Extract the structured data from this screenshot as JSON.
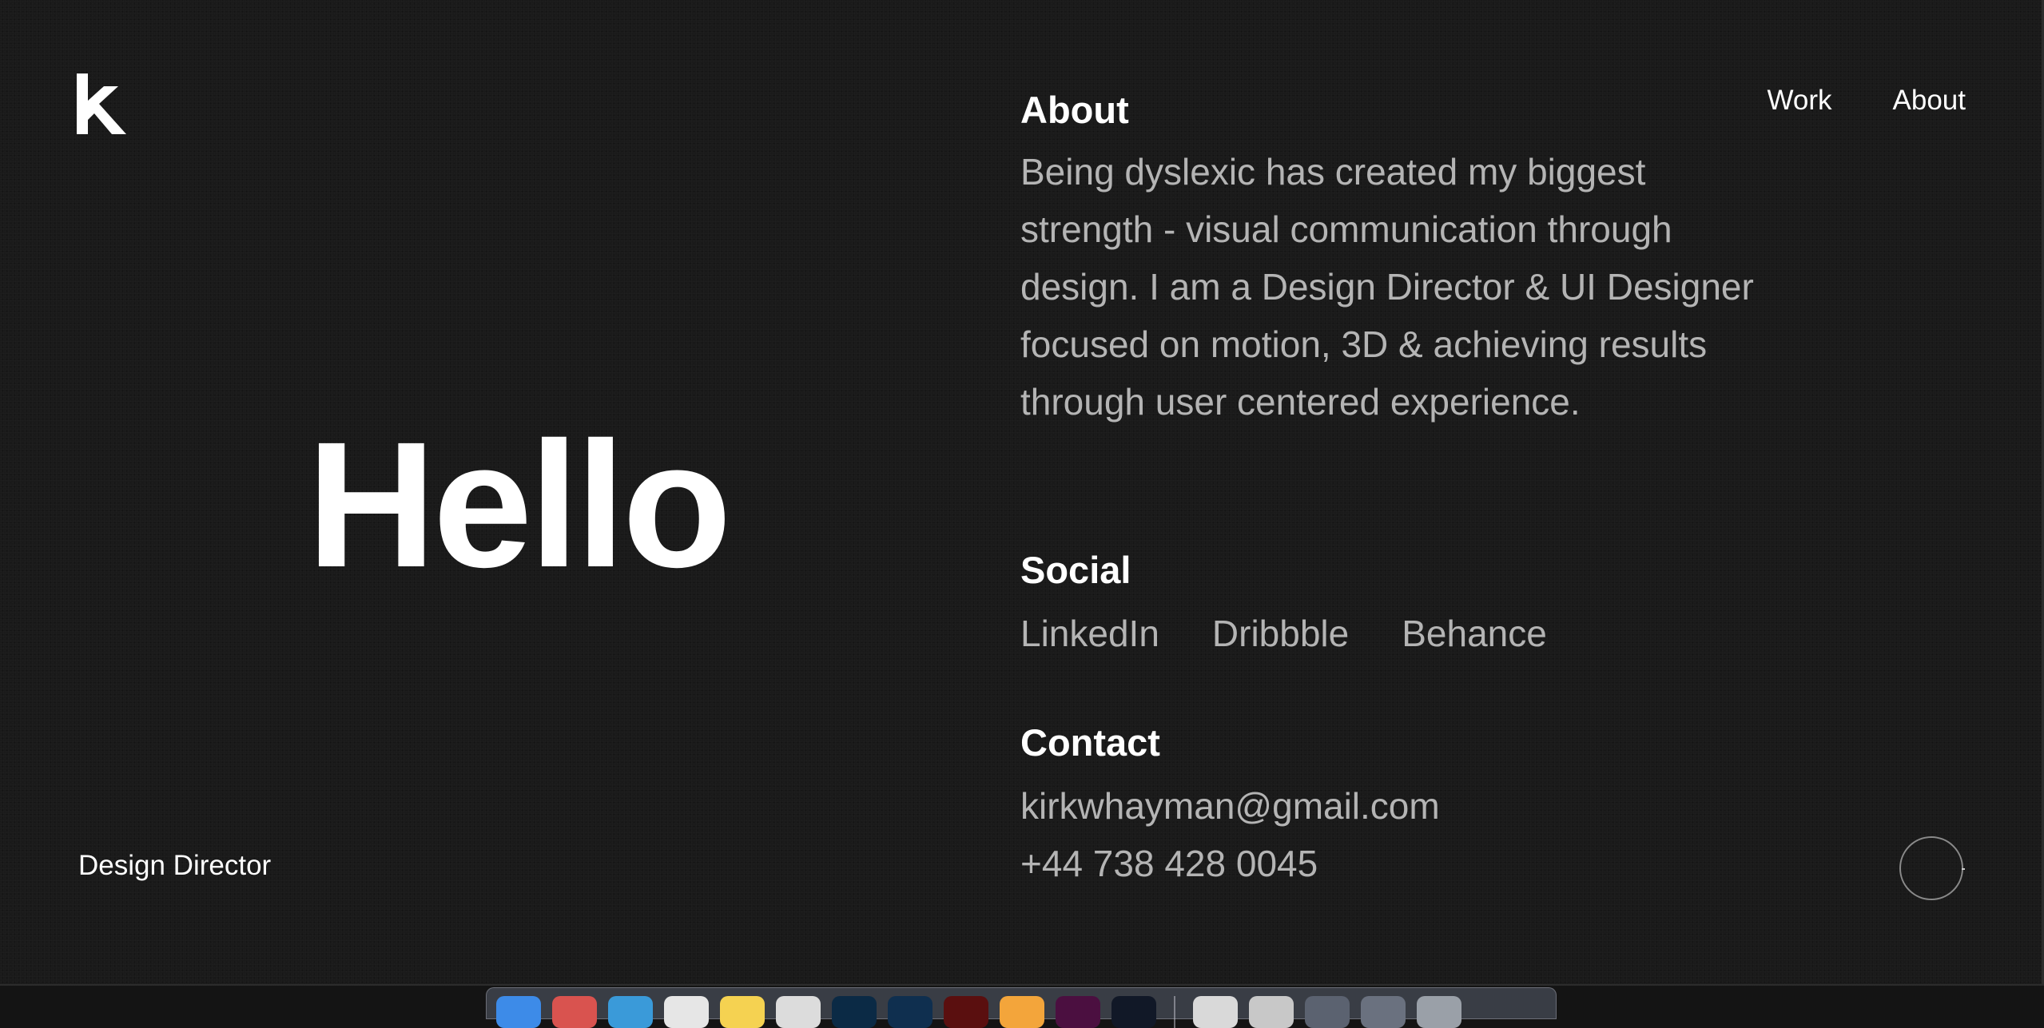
{
  "header": {
    "logo_icon": "k-logo-icon",
    "nav": [
      {
        "label": "Work"
      },
      {
        "label": "About"
      }
    ]
  },
  "hero": {
    "greeting": "Hello",
    "role": "Design Director"
  },
  "about": {
    "title": "About",
    "text": "Being dyslexic has created my biggest strength - visual communication through design. I am a Design Director & UI Designer focused on motion, 3D & achieving results through user centered experience."
  },
  "social": {
    "title": "Social",
    "links": [
      "LinkedIn",
      "Dribbble",
      "Behance"
    ]
  },
  "contact": {
    "title": "Contact",
    "email": "kirkwhayman@gmail.com",
    "phone": "+44 738 428 0045"
  },
  "dock": {
    "apps": [
      {
        "icon": "finder-icon",
        "color": "#3d8be8"
      },
      {
        "icon": "chrome-icon",
        "color": "#d9534f"
      },
      {
        "icon": "safari-icon",
        "color": "#3a9ad9"
      },
      {
        "icon": "calendar-icon",
        "color": "#e6e6e6"
      },
      {
        "icon": "notes-icon",
        "color": "#f5d251"
      },
      {
        "icon": "mail-icon",
        "color": "#dcdcdc"
      },
      {
        "icon": "photoshop-icon",
        "color": "#0b2a45"
      },
      {
        "icon": "photoshop-beta-icon",
        "color": "#0f2f4f"
      },
      {
        "icon": "acrobat-icon",
        "color": "#5a0f0f"
      },
      {
        "icon": "sketch-icon",
        "color": "#f3a53b"
      },
      {
        "icon": "xd-icon",
        "color": "#4b0f40"
      },
      {
        "icon": "terminal-icon",
        "color": "#111827"
      }
    ],
    "docs": [
      {
        "icon": "document-icon",
        "color": "#d9d9d9"
      },
      {
        "icon": "document-icon",
        "color": "#c8c8c8"
      },
      {
        "icon": "folder-icon",
        "color": "#5b6270"
      },
      {
        "icon": "folder-icon",
        "color": "#6a717f"
      },
      {
        "icon": "trash-icon",
        "color": "#9aa0a8"
      }
    ]
  }
}
